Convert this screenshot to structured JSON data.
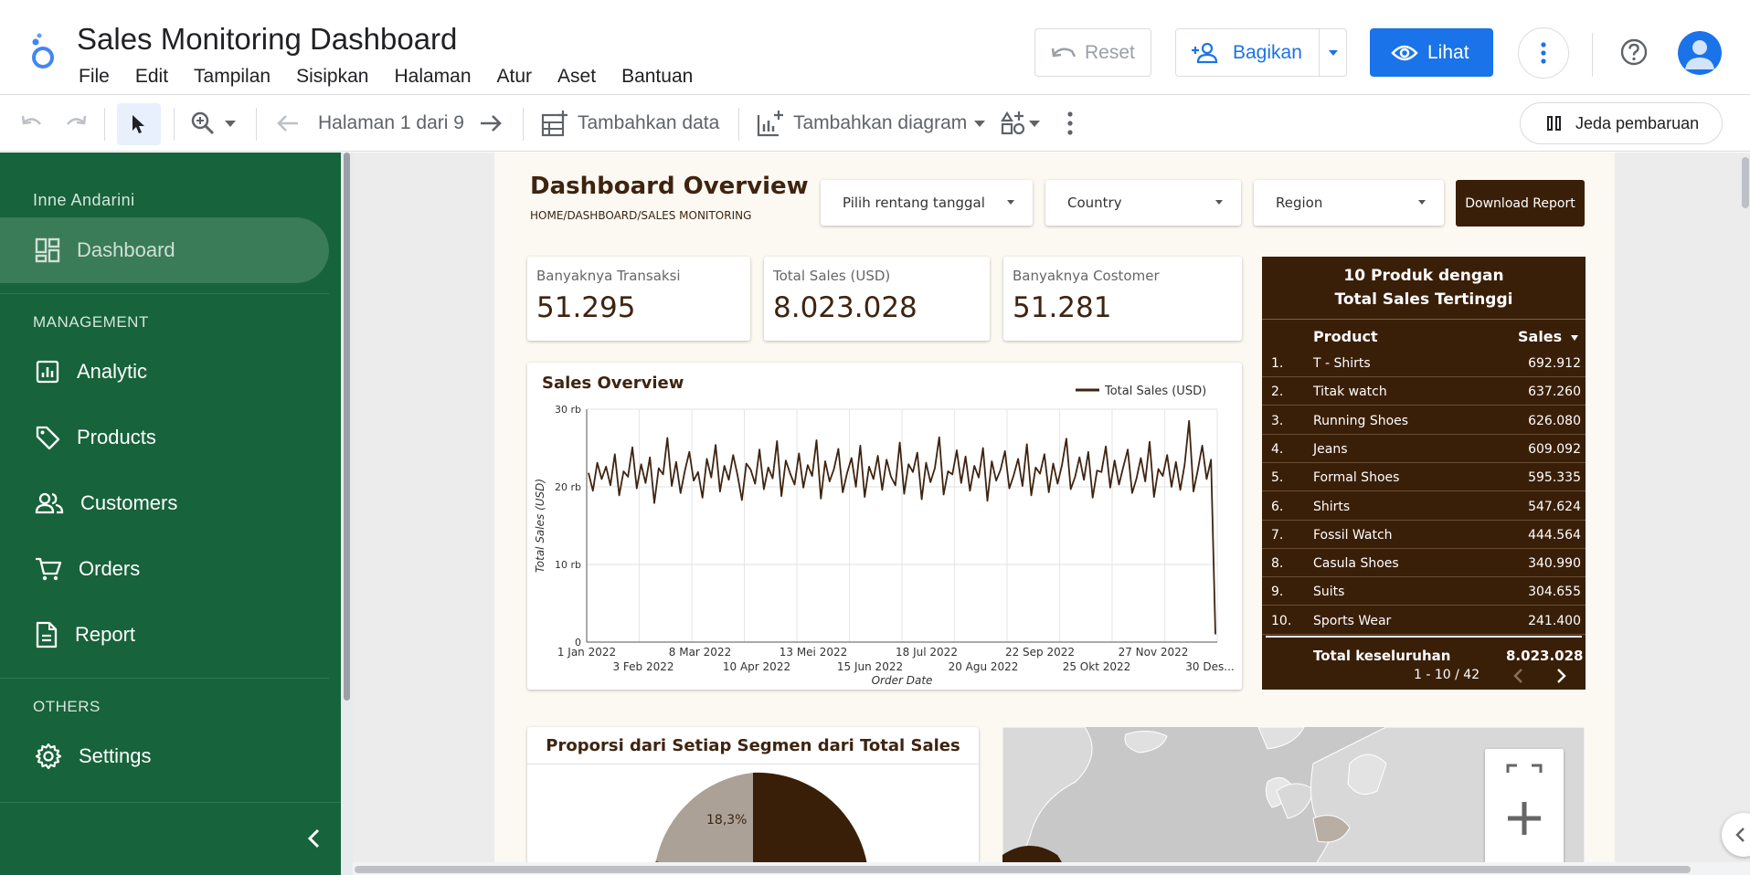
{
  "app": {
    "title": "Sales Monitoring Dashboard",
    "menu": [
      "File",
      "Edit",
      "Tampilan",
      "Sisipkan",
      "Halaman",
      "Atur",
      "Aset",
      "Bantuan"
    ],
    "reset_label": "Reset",
    "share_label": "Bagikan",
    "view_label": "Lihat"
  },
  "toolbar": {
    "page_label": "Halaman 1 dari 9",
    "add_data_label": "Tambahkan data",
    "add_chart_label": "Tambahkan diagram",
    "pause_label": "Jeda pembaruan"
  },
  "sidebar": {
    "user": "Inne Andarini",
    "dashboard_label": "Dashboard",
    "management_label": "MANAGEMENT",
    "items": [
      {
        "label": "Analytic",
        "icon": "analytics-icon"
      },
      {
        "label": "Products",
        "icon": "tag-icon"
      },
      {
        "label": "Customers",
        "icon": "people-icon"
      },
      {
        "label": "Orders",
        "icon": "cart-icon"
      },
      {
        "label": "Report",
        "icon": "document-icon"
      }
    ],
    "others_label": "OTHERS",
    "settings_label": "Settings"
  },
  "dashboard": {
    "title": "Dashboard Overview",
    "breadcrumb": "HOME/DASHBOARD/SALES MONITORING",
    "filters": {
      "date": "Pilih rentang tanggal",
      "country": "Country",
      "region": "Region"
    },
    "download_label": "Download Report",
    "kpis": [
      {
        "label": "Banyaknya Transaksi",
        "value": "51.295"
      },
      {
        "label": "Total Sales (USD)",
        "value": "8.023.028"
      },
      {
        "label": "Banyaknya Costomer",
        "value": "51.281"
      }
    ],
    "top10": {
      "title_line1": "10 Produk dengan",
      "title_line2": "Total Sales Tertinggi",
      "col_product": "Product",
      "col_sales": "Sales",
      "rows": [
        {
          "rank": "1.",
          "product": "T - Shirts",
          "sales": "692.912"
        },
        {
          "rank": "2.",
          "product": "Titak watch",
          "sales": "637.260"
        },
        {
          "rank": "3.",
          "product": "Running Shoes",
          "sales": "626.080"
        },
        {
          "rank": "4.",
          "product": "Jeans",
          "sales": "609.092"
        },
        {
          "rank": "5.",
          "product": "Formal Shoes",
          "sales": "595.335"
        },
        {
          "rank": "6.",
          "product": "Shirts",
          "sales": "547.624"
        },
        {
          "rank": "7.",
          "product": "Fossil Watch",
          "sales": "444.564"
        },
        {
          "rank": "8.",
          "product": "Casula Shoes",
          "sales": "340.990"
        },
        {
          "rank": "9.",
          "product": "Suits",
          "sales": "304.655"
        },
        {
          "rank": "10.",
          "product": "Sports Wear",
          "sales": "241.400"
        }
      ],
      "total_label": "Total keseluruhan",
      "total_value": "8.023.028",
      "pager": "1 - 10 / 42"
    },
    "pie": {
      "title": "Proporsi dari Setiap Segmen dari Total Sales",
      "visible_label": "18,3%"
    }
  },
  "chart_data": {
    "type": "line",
    "title": "Sales Overview",
    "xlabel": "Order Date",
    "ylabel": "Total Sales (USD)",
    "legend": "top-right",
    "ylim": [
      0,
      30000
    ],
    "y_ticks": [
      "0",
      "10 rb",
      "20 rb",
      "30 rb"
    ],
    "x_ticks_row1": [
      "1 Jan 2022",
      "8 Mar 2022",
      "13 Mei 2022",
      "18 Jul 2022",
      "22 Sep 2022",
      "27 Nov 2022"
    ],
    "x_ticks_row2": [
      "3 Feb 2022",
      "10 Apr 2022",
      "15 Jun 2022",
      "20 Agu 2022",
      "25 Okt 2022",
      "30 Des..."
    ],
    "series": [
      {
        "name": "Total Sales (USD)",
        "color": "#3e2410",
        "x_start": "2022-01-01",
        "x_end": "2022-12-31",
        "values": [
          21800,
          19500,
          23100,
          21000,
          22600,
          20200,
          24200,
          18900,
          22000,
          21300,
          25100,
          19800,
          22900,
          20500,
          23800,
          17900,
          22400,
          21600,
          26300,
          20100,
          23200,
          19200,
          22100,
          24500,
          20800,
          21900,
          18600,
          23600,
          21200,
          25400,
          19400,
          22700,
          20900,
          24100,
          21500,
          18300,
          23000,
          22200,
          20400,
          24800,
          19700,
          22500,
          21100,
          25900,
          18800,
          23400,
          21700,
          20300,
          24300,
          19900,
          22800,
          21400,
          26000,
          18500,
          23300,
          20700,
          22300,
          24900,
          19300,
          21800,
          23700,
          20000,
          25300,
          18700,
          22600,
          21000,
          24000,
          19600,
          23500,
          21300,
          20200,
          25700,
          19100,
          22900,
          21900,
          24400,
          18400,
          23100,
          20600,
          22400,
          26400,
          19000,
          22000,
          21600,
          24700,
          20500,
          23900,
          19500,
          22700,
          21200,
          25000,
          18200,
          23300,
          20800,
          22200,
          24600,
          19800,
          21500,
          23600,
          20100,
          25500,
          18900,
          22500,
          21700,
          24200,
          19300,
          23000,
          20400,
          22800,
          26200,
          19700,
          21300,
          23800,
          20900,
          24500,
          18600,
          22100,
          21900,
          25200,
          19900,
          23400,
          20300,
          22600,
          24800,
          19200,
          21100,
          23700,
          20700,
          25800,
          18700,
          22300,
          21400,
          24100,
          20000,
          23200,
          19600,
          22900,
          28500,
          19400,
          22200,
          25300,
          21000,
          23500,
          1000
        ]
      }
    ]
  }
}
